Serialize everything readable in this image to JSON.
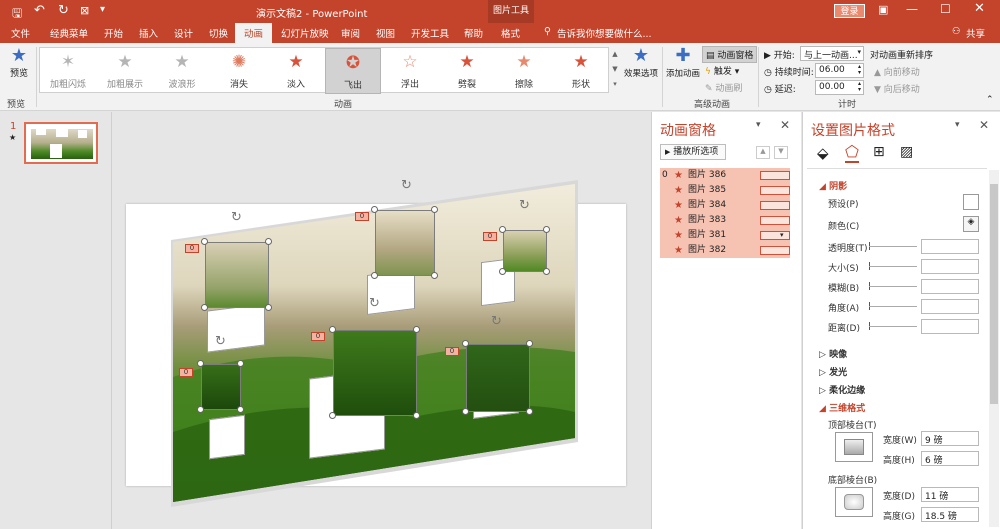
{
  "window": {
    "document_title": "演示文稿2 - PowerPoint",
    "context_tool": "图片工具",
    "login_label": "登录",
    "share_label": "共享",
    "tell_me": "告诉我你想要做什么..."
  },
  "tabs": [
    {
      "label": "文件"
    },
    {
      "label": "经典菜单"
    },
    {
      "label": "开始"
    },
    {
      "label": "插入"
    },
    {
      "label": "设计"
    },
    {
      "label": "切换"
    },
    {
      "label": "动画"
    },
    {
      "label": "幻灯片放映"
    },
    {
      "label": "审阅"
    },
    {
      "label": "视图"
    },
    {
      "label": "开发工具"
    },
    {
      "label": "帮助"
    },
    {
      "label": "格式"
    }
  ],
  "ribbon": {
    "preview_label": "预览",
    "preview_group": "预览",
    "animation_group": "动画",
    "advanced_group": "高级动画",
    "timing_group": "计时",
    "animations": [
      {
        "label": "加粗闪烁",
        "icon": "star-icon"
      },
      {
        "label": "加粗展示",
        "icon": "star-icon"
      },
      {
        "label": "波浪形",
        "icon": "star-icon"
      },
      {
        "label": "消失",
        "icon": "burst-icon"
      },
      {
        "label": "淡入",
        "icon": "star-icon"
      },
      {
        "label": "飞出",
        "icon": "star-icon"
      },
      {
        "label": "浮出",
        "icon": "star-icon"
      },
      {
        "label": "劈裂",
        "icon": "star-icon"
      },
      {
        "label": "擦除",
        "icon": "star-icon"
      },
      {
        "label": "形状",
        "icon": "star-icon"
      }
    ],
    "effect_options": "效果选项",
    "add_animation": "添加动画",
    "anim_pane_btn": "动画窗格",
    "trigger_btn": "触发",
    "anim_painter_btn": "动画刷",
    "start_label": "开始:",
    "start_value": "与上一动画...",
    "duration_label": "持续时间:",
    "duration_value": "06.00",
    "delay_label": "延迟:",
    "delay_value": "00.00",
    "reorder_label": "对动画重新排序",
    "move_earlier": "向前移动",
    "move_later": "向后移动"
  },
  "thumbnails": [
    {
      "number": "1",
      "star": "★"
    }
  ],
  "anim_pane": {
    "title": "动画窗格",
    "play_label": "播放所选项",
    "items": [
      {
        "index": "0",
        "name": "图片 386"
      },
      {
        "index": "",
        "name": "图片 385"
      },
      {
        "index": "",
        "name": "图片 384"
      },
      {
        "index": "",
        "name": "图片 383"
      },
      {
        "index": "",
        "name": "图片 381"
      },
      {
        "index": "",
        "name": "图片 382"
      }
    ]
  },
  "format_pane": {
    "title": "设置图片格式",
    "shadow_section": "阴影",
    "shadow_rows": [
      {
        "label": "预设(P)"
      },
      {
        "label": "颜色(C)"
      },
      {
        "label": "透明度(T)"
      },
      {
        "label": "大小(S)"
      },
      {
        "label": "模糊(B)"
      },
      {
        "label": "角度(A)"
      },
      {
        "label": "距离(D)"
      }
    ],
    "collapsed_sections": [
      "映像",
      "发光",
      "柔化边缘"
    ],
    "threed_section": "三维格式",
    "top_bevel": "顶部棱台(T)",
    "bottom_bevel": "底部棱台(B)",
    "width_label": "宽度(W)",
    "height_label": "高度(H)",
    "top_width": "9 磅",
    "top_height": "6 磅",
    "bottom_width_label": "宽度(D)",
    "bottom_height_label": "高度(G)",
    "bottom_width": "11 磅",
    "bottom_height": "18.5 磅"
  },
  "slide_tags": [
    "0",
    "0",
    "0",
    "0",
    "0",
    "0"
  ],
  "colors": {
    "accent": "#c4432b",
    "selected_row": "#f6c3b3"
  }
}
